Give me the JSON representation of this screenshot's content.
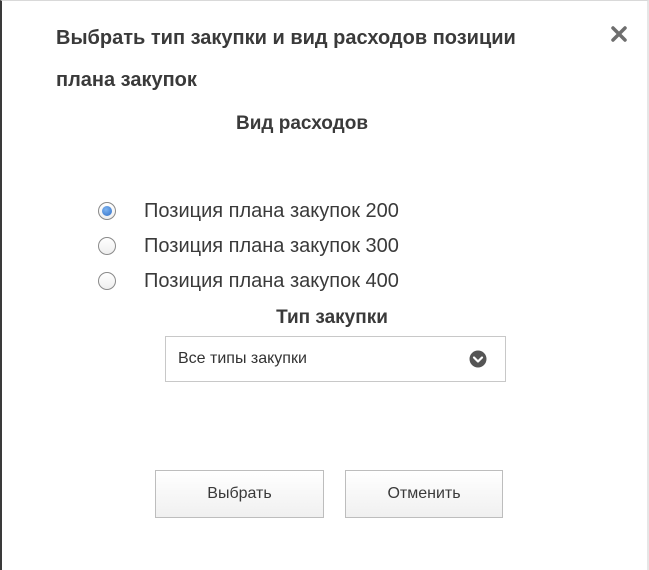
{
  "dialog": {
    "title": "Выбрать тип закупки и вид расходов позиции плана закупок",
    "close_icon": "close-icon"
  },
  "expense": {
    "heading": "Вид расходов",
    "options": [
      {
        "label": "Позиция плана закупок 200",
        "checked": true
      },
      {
        "label": "Позиция плана закупок 300",
        "checked": false
      },
      {
        "label": "Позиция плана закупок 400",
        "checked": false
      }
    ]
  },
  "purchase": {
    "heading": "Тип закупки",
    "selected": "Все типы закупки",
    "icon": "chevron-down-icon"
  },
  "buttons": {
    "select_label": "Выбрать",
    "cancel_label": "Отменить"
  },
  "colors": {
    "text": "#3a3a3a",
    "radio_selected": "#2f6fc8",
    "border": "#c8c8c8"
  }
}
